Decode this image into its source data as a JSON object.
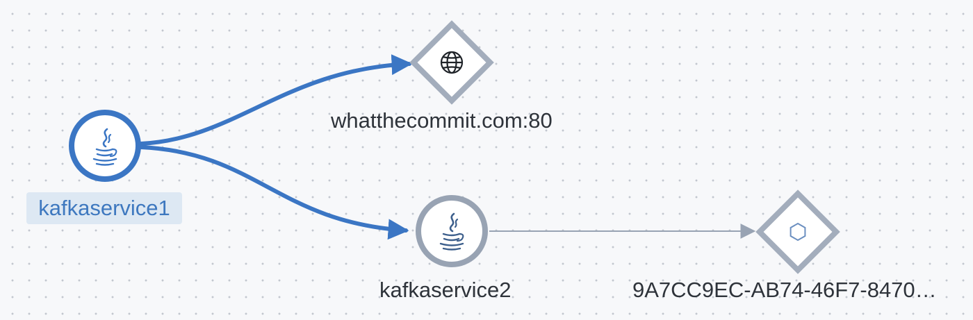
{
  "graph": {
    "accent_color": "#3b76c4",
    "inactive_color": "#98a3b3",
    "nodes": [
      {
        "id": "kafkaservice1",
        "label": "kafkaservice1",
        "kind": "service",
        "icon": "java-icon",
        "selected": true
      },
      {
        "id": "whatthecommit",
        "label": "whatthecommit.com:80",
        "kind": "external",
        "icon": "globe-icon",
        "selected": false
      },
      {
        "id": "kafkaservice2",
        "label": "kafkaservice2",
        "kind": "service",
        "icon": "java-icon",
        "selected": false
      },
      {
        "id": "uuid",
        "label": "9A7CC9EC-AB74-46F7-8470…",
        "kind": "dependency",
        "icon": "hexagon-icon",
        "selected": false
      }
    ],
    "edges": [
      {
        "from": "kafkaservice1",
        "to": "whatthecommit",
        "highlighted": true
      },
      {
        "from": "kafkaservice1",
        "to": "kafkaservice2",
        "highlighted": true
      },
      {
        "from": "kafkaservice2",
        "to": "uuid",
        "highlighted": false
      }
    ]
  }
}
